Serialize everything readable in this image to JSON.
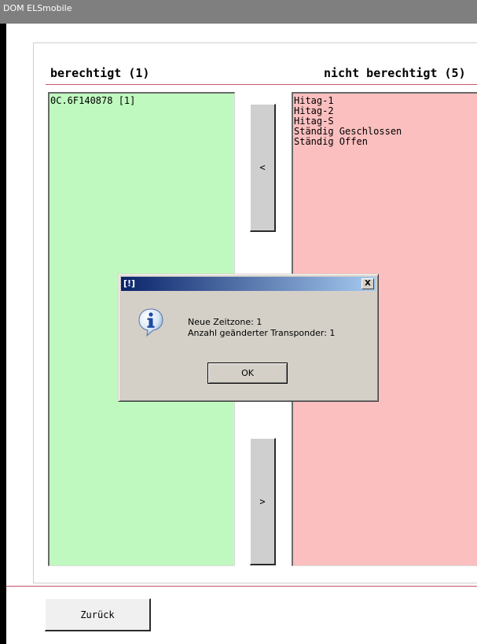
{
  "window": {
    "title": "DOM ELSmobile"
  },
  "lists": {
    "allowed": {
      "heading": "berechtigt (1)",
      "items": [
        "0C.6F140878 [1]"
      ]
    },
    "not_allowed": {
      "heading": "nicht berechtigt (5)",
      "items": [
        "Hitag-1",
        "Hitag-2",
        "Hitag-S",
        "Ständig Geschlossen",
        "Ständig Offen"
      ]
    }
  },
  "buttons": {
    "move_left": "<",
    "move_right": ">",
    "back": "Zurück"
  },
  "dialog": {
    "title": "[!]",
    "close_glyph": "X",
    "icon": "info-icon",
    "line1": "Neue Zeitzone: 1",
    "line2": "Anzahl geänderter Transponder: 1",
    "ok_label": "OK"
  },
  "colors": {
    "allowed_bg": "#bff9bf",
    "not_allowed_bg": "#fbbfbf",
    "accent_line": "#c9506a",
    "dialog_title_start": "#0a246a"
  }
}
